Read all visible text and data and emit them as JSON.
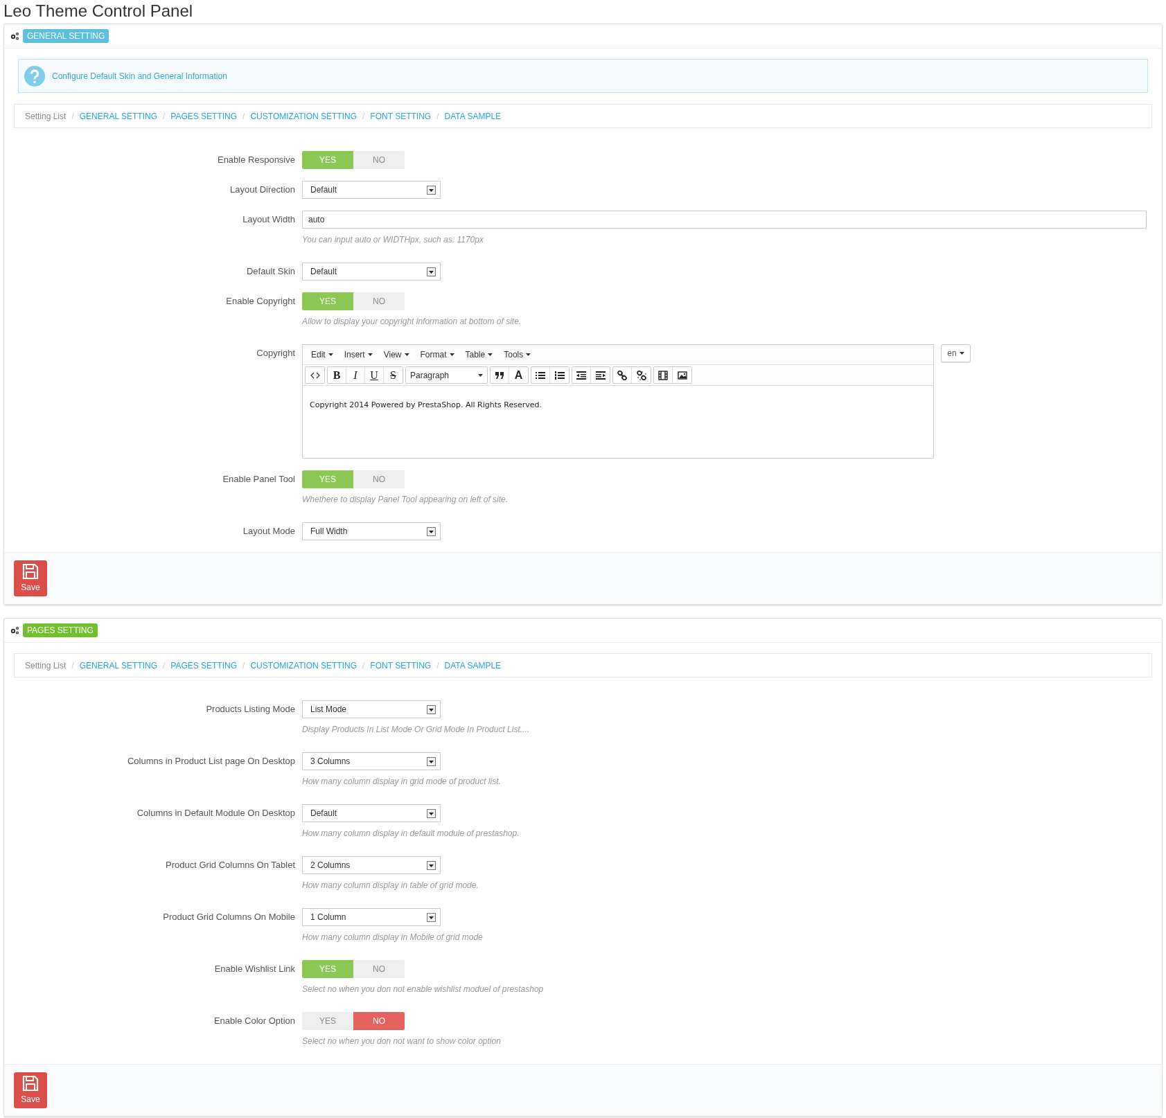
{
  "page_title": "Leo Theme Control Panel",
  "panels": [
    {
      "title": "GENERAL SETTING",
      "color": "#5bc0de",
      "info": "Configure Default Skin and General Information",
      "breadcrumb": [
        {
          "kind": "root",
          "label": "Setting List"
        },
        {
          "kind": "separator",
          "label": "/"
        },
        {
          "kind": "link",
          "label": "GENERAL SETTING"
        },
        {
          "kind": "separator",
          "label": "/"
        },
        {
          "kind": "link",
          "label": "PAGES SETTING"
        },
        {
          "kind": "separator",
          "label": "/"
        },
        {
          "kind": "link",
          "label": "CUSTOMIZATION SETTING"
        },
        {
          "kind": "separator",
          "label": "/"
        },
        {
          "kind": "link",
          "label": "FONT SETTING"
        },
        {
          "kind": "separator",
          "label": "/"
        },
        {
          "kind": "link",
          "label": "DATA SAMPLE"
        }
      ],
      "fields": [
        {
          "kind": "toggle",
          "label": "Enable Responsive",
          "yes": "YES",
          "no": "NO",
          "on": true
        },
        {
          "kind": "select",
          "label": "Layout Direction",
          "value": "Default"
        },
        {
          "kind": "text",
          "label": "Layout Width",
          "value": "auto",
          "help": "You can input auto or WIDTHpx, such as: 1170px"
        },
        {
          "kind": "select",
          "label": "Default Skin",
          "value": "Default"
        },
        {
          "kind": "toggle",
          "label": "Enable Copyright",
          "yes": "YES",
          "no": "NO",
          "on": true,
          "help": "Allow to display your copyright information at bottom of site."
        },
        {
          "kind": "editor",
          "label": "Copyright",
          "menus": [
            {
              "label": "Edit"
            },
            {
              "label": "Insert"
            },
            {
              "label": "View"
            },
            {
              "label": "Format"
            },
            {
              "label": "Table"
            },
            {
              "label": "Tools"
            }
          ],
          "toolbar": [
            [
              {
                "kind": "code"
              }
            ],
            [
              {
                "kind": "bold",
                "label": "B"
              },
              {
                "kind": "italic",
                "label": "I"
              },
              {
                "kind": "underline",
                "label": "U"
              },
              {
                "kind": "strike",
                "label": "S"
              }
            ],
            [
              {
                "kind": "format",
                "label": "Paragraph"
              }
            ],
            [
              {
                "kind": "quote"
              },
              {
                "kind": "color",
                "label": "A"
              }
            ],
            [
              {
                "kind": "bullets"
              },
              {
                "kind": "numbers"
              }
            ],
            [
              {
                "kind": "outdent"
              },
              {
                "kind": "indent"
              }
            ],
            [
              {
                "kind": "link"
              },
              {
                "kind": "unlink"
              }
            ],
            [
              {
                "kind": "media"
              },
              {
                "kind": "image"
              }
            ]
          ],
          "content": "Copyright 2014 Powered by PrestaShop. All Rights Reserved.",
          "language": "en"
        },
        {
          "kind": "toggle",
          "label": "Enable Panel Tool",
          "yes": "YES",
          "no": "NO",
          "on": true,
          "help": "Whethere to display Panel Tool appearing on left of site."
        },
        {
          "kind": "select",
          "label": "Layout Mode",
          "value": "Full Width"
        }
      ],
      "save": "Save"
    },
    {
      "title": "PAGES SETTING",
      "color": "#72c02c",
      "breadcrumb": [
        {
          "kind": "root",
          "label": "Setting List"
        },
        {
          "kind": "separator",
          "label": "/"
        },
        {
          "kind": "link",
          "label": "GENERAL SETTING"
        },
        {
          "kind": "separator",
          "label": "/"
        },
        {
          "kind": "link",
          "label": "PAGES SETTING"
        },
        {
          "kind": "separator",
          "label": "/"
        },
        {
          "kind": "link",
          "label": "CUSTOMIZATION SETTING"
        },
        {
          "kind": "separator",
          "label": "/"
        },
        {
          "kind": "link",
          "label": "FONT SETTING"
        },
        {
          "kind": "separator",
          "label": "/"
        },
        {
          "kind": "link",
          "label": "DATA SAMPLE"
        }
      ],
      "fields": [
        {
          "kind": "select",
          "label": "Products Listing Mode",
          "value": "List Mode",
          "help": "Display Products In List Mode Or Grid Mode In Product List...."
        },
        {
          "kind": "select",
          "label": "Columns in Product List page On Desktop",
          "value": "3 Columns",
          "help": "How many column display in grid mode of product list."
        },
        {
          "kind": "select",
          "label": "Columns in Default Module On Desktop",
          "value": "Default",
          "help": "How many column display in default module of prestashop."
        },
        {
          "kind": "select",
          "label": "Product Grid Columns On Tablet",
          "value": "2 Columns",
          "help": "How many column display in table of grid mode."
        },
        {
          "kind": "select",
          "label": "Product Grid Columns On Mobile",
          "value": "1 Column",
          "help": "How many column display in Mobile of grid mode"
        },
        {
          "kind": "toggle",
          "label": "Enable Wishlist Link",
          "yes": "YES",
          "no": "NO",
          "on": true,
          "help": "Select no when you don not enable wishlist moduel of prestashop"
        },
        {
          "kind": "toggle",
          "label": "Enable Color Option",
          "yes": "YES",
          "no": "NO",
          "on": false,
          "help": "Select no when you don not want to show color option"
        }
      ],
      "save": "Save"
    }
  ]
}
